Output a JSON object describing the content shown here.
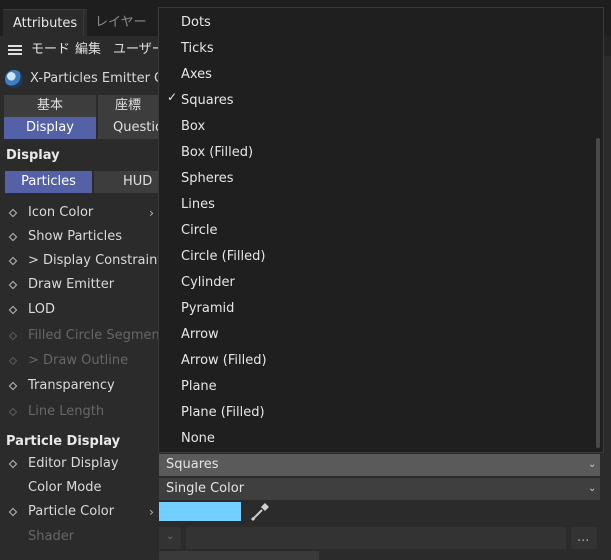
{
  "tabs": {
    "active": "Attributes",
    "inactive": "レイヤー"
  },
  "toolbar": {
    "mode": "モード",
    "edit": "編集",
    "user": "ユーザーデ"
  },
  "object": {
    "title": "X-Particles Emitter Obj"
  },
  "top_tabs": {
    "row1": [
      "基本",
      "座標"
    ],
    "row2": [
      "Display",
      "Questio"
    ]
  },
  "display_section": {
    "title": "Display",
    "subtabs": [
      "Particles",
      "HUD"
    ]
  },
  "properties": [
    {
      "label": "Icon Color",
      "enabled": true,
      "diamond": true
    },
    {
      "label": "Show Particles",
      "enabled": true,
      "diamond": true
    },
    {
      "label": "> Display Constraints",
      "enabled": true,
      "diamond": true
    },
    {
      "label": "Draw Emitter",
      "enabled": true,
      "diamond": true
    },
    {
      "label": "LOD",
      "enabled": true,
      "diamond": true
    },
    {
      "label": "Filled Circle Segments",
      "enabled": false,
      "diamond": true
    },
    {
      "label": "> Draw Outline",
      "enabled": false,
      "diamond": true
    },
    {
      "label": "Transparency",
      "enabled": true,
      "diamond": true
    },
    {
      "label": "Line Length",
      "enabled": false,
      "diamond": true
    }
  ],
  "particle_display": {
    "title": "Particle Display",
    "editor_display_label": "Editor Display",
    "editor_display_value": "Squares",
    "color_mode_label": "Color Mode",
    "color_mode_value": "Single Color",
    "particle_color_label": "Particle Color",
    "particle_color_hex": "#72cfff",
    "shader_label": "Shader"
  },
  "popup_menu": {
    "items": [
      "Dots",
      "Ticks",
      "Axes",
      "Squares",
      "Box",
      "Box (Filled)",
      "Spheres",
      "Lines",
      "Circle",
      "Circle (Filled)",
      "Cylinder",
      "Pyramid",
      "Arrow",
      "Arrow (Filled)",
      "Plane",
      "Plane (Filled)",
      "None"
    ],
    "checked": "Squares"
  },
  "misc": {
    "ellipsis": "..."
  },
  "colors": {
    "accent_blue": "#5561a6",
    "panel": "#2b2b2b",
    "popup": "#1f1f1f"
  }
}
